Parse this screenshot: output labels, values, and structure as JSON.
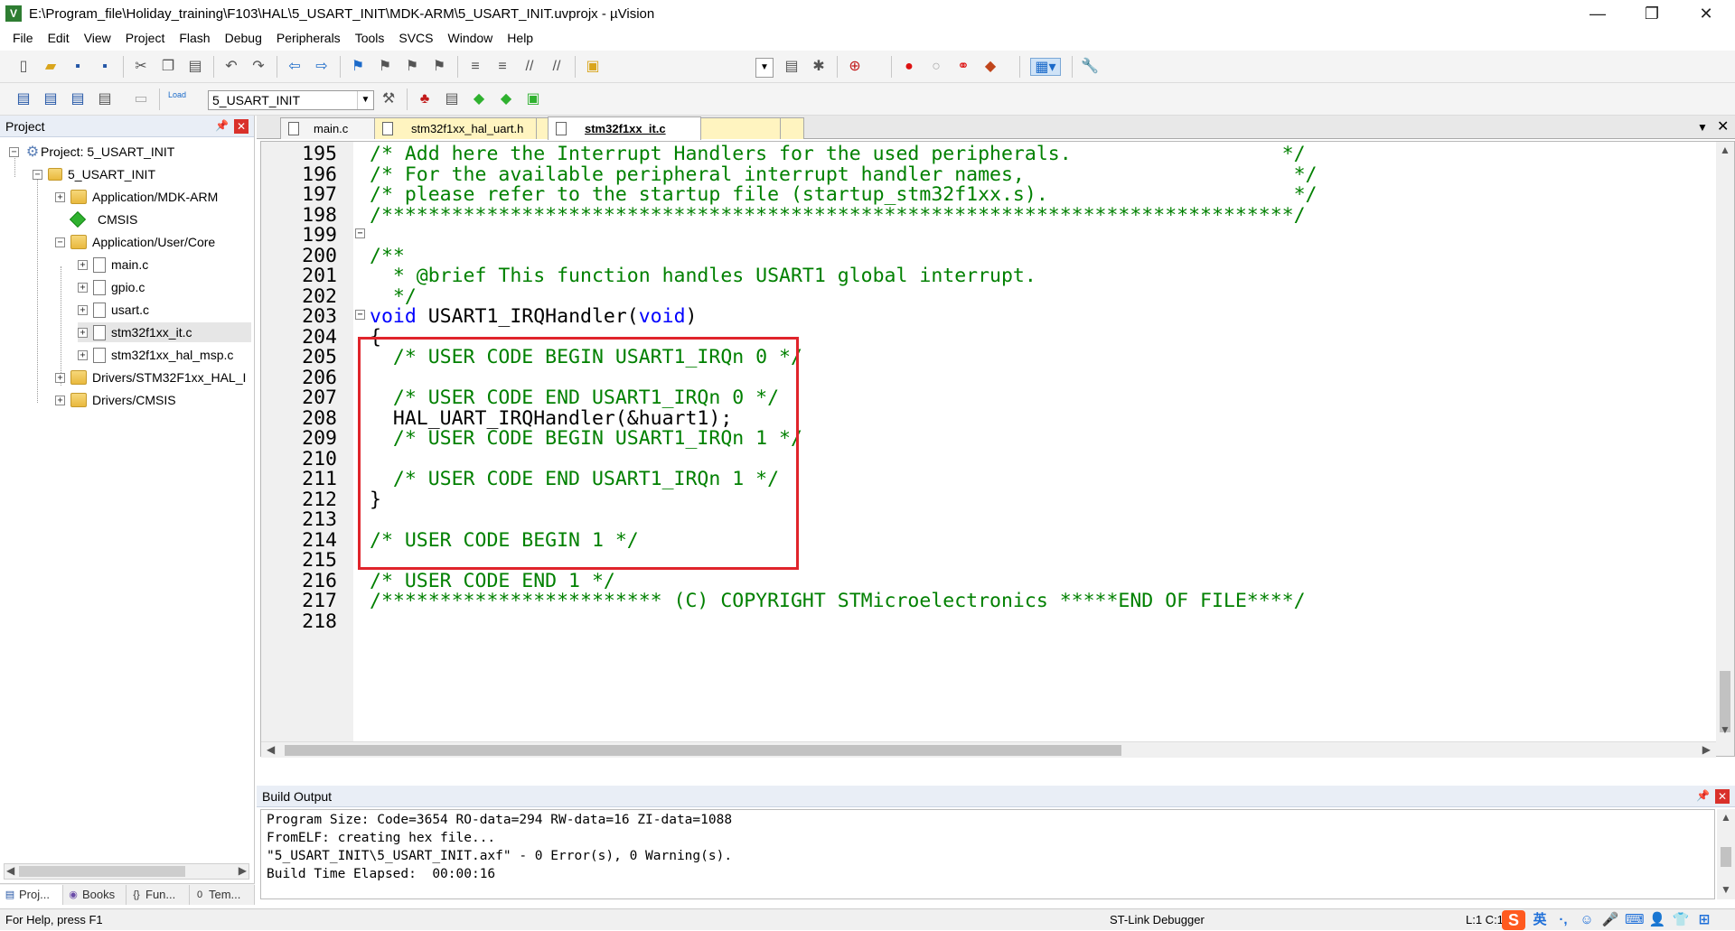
{
  "title": "E:\\Program_file\\Holiday_training\\F103\\HAL\\5_USART_INIT\\MDK-ARM\\5_USART_INIT.uvprojx - µVision",
  "window_controls": [
    "—",
    "❐",
    "✕"
  ],
  "menu": [
    "File",
    "Edit",
    "View",
    "Project",
    "Flash",
    "Debug",
    "Peripherals",
    "Tools",
    "SVCS",
    "Window",
    "Help"
  ],
  "toolbar": {
    "target": "5_USART_INIT",
    "load_label": "Load"
  },
  "project_panel": {
    "title": "Project",
    "tree": [
      {
        "label": "Project: 5_USART_INIT",
        "icon": "project-icon",
        "level": 0,
        "expander": "−"
      },
      {
        "label": "5_USART_INIT",
        "icon": "target-icon",
        "level": 1,
        "expander": "−"
      },
      {
        "label": "Application/MDK-ARM",
        "icon": "folder-icon",
        "level": 2,
        "expander": "+"
      },
      {
        "label": "CMSIS",
        "icon": "cmsis-icon",
        "level": 2,
        "expander": ""
      },
      {
        "label": "Application/User/Core",
        "icon": "folder-icon",
        "level": 2,
        "expander": "−"
      },
      {
        "label": "main.c",
        "icon": "file-icon",
        "level": 3,
        "expander": "+"
      },
      {
        "label": "gpio.c",
        "icon": "file-icon",
        "level": 3,
        "expander": "+"
      },
      {
        "label": "usart.c",
        "icon": "file-icon",
        "level": 3,
        "expander": "+"
      },
      {
        "label": "stm32f1xx_it.c",
        "icon": "file-icon",
        "level": 3,
        "expander": "+",
        "selected": true
      },
      {
        "label": "stm32f1xx_hal_msp.c",
        "icon": "file-icon",
        "level": 3,
        "expander": "+"
      },
      {
        "label": "Drivers/STM32F1xx_HAL_I",
        "icon": "folder-icon",
        "level": 2,
        "expander": "+"
      },
      {
        "label": "Drivers/CMSIS",
        "icon": "folder-icon",
        "level": 2,
        "expander": "+"
      }
    ],
    "tabs": [
      {
        "label": "Proj...",
        "icon": "project-tab-icon"
      },
      {
        "label": "Books",
        "icon": "books-icon"
      },
      {
        "label": "Fun...",
        "icon": "functions-icon"
      },
      {
        "label": "Tem...",
        "icon": "templates-icon"
      }
    ]
  },
  "editor_tabs": [
    {
      "label": "main.c",
      "active": false
    },
    {
      "label": "stm32f1xx_hal_uart.h",
      "active": false
    },
    {
      "label": "stm32f1xx_it.c",
      "active": true
    }
  ],
  "code_lines": [
    {
      "num": "195",
      "text": "/* Add here the Interrupt Handlers for the used peripherals.                  */",
      "kind": "comment"
    },
    {
      "num": "196",
      "text": "/* For the available peripheral interrupt handler names,                       */",
      "kind": "comment"
    },
    {
      "num": "197",
      "text": "/* please refer to the startup file (startup_stm32f1xx.s).                     */",
      "kind": "comment"
    },
    {
      "num": "198",
      "text": "/******************************************************************************/",
      "kind": "comment"
    },
    {
      "num": "199",
      "text": "",
      "kind": "text"
    },
    {
      "num": "200",
      "text": "/**",
      "kind": "comment"
    },
    {
      "num": "201",
      "text": "  * @brief This function handles USART1 global interrupt.",
      "kind": "comment"
    },
    {
      "num": "202",
      "text": "  */",
      "kind": "comment"
    },
    {
      "num": "203",
      "text": "USART1_IRQHandler(",
      "kind": "signature",
      "kw1": "void",
      "kw2": "void",
      "tail": ")"
    },
    {
      "num": "204",
      "text": "{",
      "kind": "text"
    },
    {
      "num": "205",
      "text": "  /* USER CODE BEGIN USART1_IRQn 0 */",
      "kind": "comment"
    },
    {
      "num": "206",
      "text": "",
      "kind": "text"
    },
    {
      "num": "207",
      "text": "  /* USER CODE END USART1_IRQn 0 */",
      "kind": "comment"
    },
    {
      "num": "208",
      "text": "  HAL_UART_IRQHandler(&huart1);",
      "kind": "text"
    },
    {
      "num": "209",
      "text": "  /* USER CODE BEGIN USART1_IRQn 1 */",
      "kind": "comment"
    },
    {
      "num": "210",
      "text": "",
      "kind": "text"
    },
    {
      "num": "211",
      "text": "  /* USER CODE END USART1_IRQn 1 */",
      "kind": "comment"
    },
    {
      "num": "212",
      "text": "}",
      "kind": "text"
    },
    {
      "num": "213",
      "text": "",
      "kind": "text"
    },
    {
      "num": "214",
      "text": "/* USER CODE BEGIN 1 */",
      "kind": "comment"
    },
    {
      "num": "215",
      "text": "",
      "kind": "text"
    },
    {
      "num": "216",
      "text": "/* USER CODE END 1 */",
      "kind": "comment"
    },
    {
      "num": "217",
      "text": "/************************ (C) COPYRIGHT STMicroelectronics *****END OF FILE****/",
      "kind": "comment"
    },
    {
      "num": "218",
      "text": "",
      "kind": "text"
    }
  ],
  "build_output": {
    "title": "Build Output",
    "lines": [
      "Program Size: Code=3654 RO-data=294 RW-data=16 ZI-data=1088",
      "FromELF: creating hex file...",
      "\"5_USART_INIT\\5_USART_INIT.axf\" - 0 Error(s), 0 Warning(s).",
      "Build Time Elapsed:  00:00:16"
    ]
  },
  "status": {
    "help": "For Help, press F1",
    "debugger": "ST-Link Debugger",
    "position": "L:1 C:1",
    "ime_lang": "英",
    "ime_logo": "S"
  },
  "colors": {
    "comment": "#008000",
    "keyword": "#0000ff",
    "highlight_box": "#e0242b"
  }
}
